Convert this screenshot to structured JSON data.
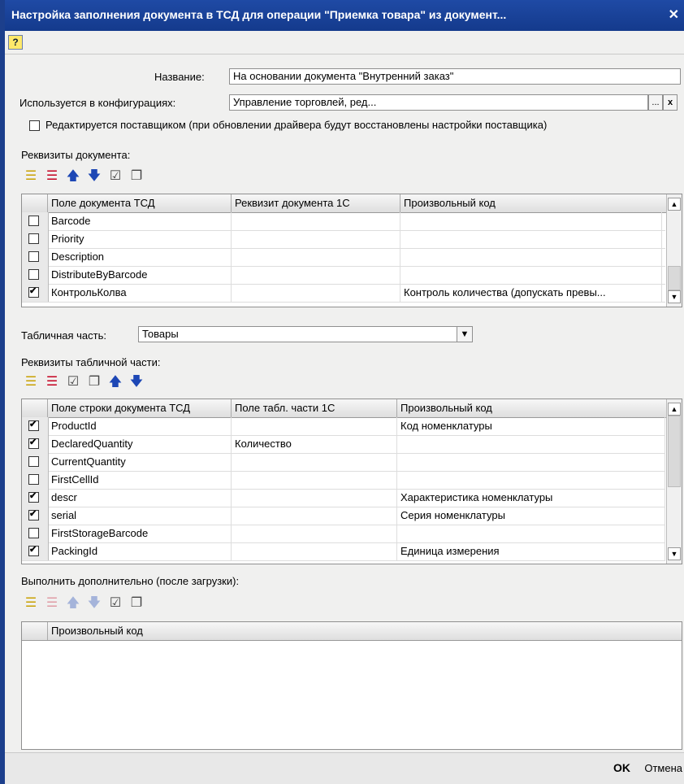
{
  "window": {
    "title": "Настройка заполнения документа в ТСД для операции \"Приемка товара\" из документ...",
    "close_symbol": "✕"
  },
  "help_label": "?",
  "name_label": "Название:",
  "name_value": "На основании документа \"Внутренний заказ\"",
  "config_label": "Используется в конфигурациях:",
  "config_value": "Управление торговлей, ред...",
  "config_select_btn": "...",
  "config_clear_btn": "x",
  "supplier_checkbox_label": "Редактируется поставщиком (при обновлении драйвера будут восстановлены настройки поставщика)",
  "doc_attrs": {
    "label": "Реквизиты документа:",
    "columns": [
      "Поле документа ТСД",
      "Реквизит документа 1С",
      "Произвольный код"
    ],
    "rows": [
      {
        "checked": false,
        "field": "Barcode",
        "attr": "",
        "code": ""
      },
      {
        "checked": false,
        "field": "Priority",
        "attr": "",
        "code": ""
      },
      {
        "checked": false,
        "field": "Description",
        "attr": "",
        "code": ""
      },
      {
        "checked": false,
        "field": "DistributeByBarcode",
        "attr": "",
        "code": ""
      },
      {
        "checked": true,
        "field": "КонтрольКолва",
        "attr": "",
        "code": "Контроль количества (допускать превы..."
      }
    ]
  },
  "table_part": {
    "label": "Табличная часть:",
    "value": "Товары"
  },
  "table_attrs": {
    "label": "Реквизиты табличной части:",
    "columns": [
      "Поле строки документа ТСД",
      "Поле табл. части 1С",
      "Произвольный код"
    ],
    "rows": [
      {
        "checked": true,
        "field": "ProductId",
        "attr": "",
        "code": "Код номенклатуры"
      },
      {
        "checked": true,
        "field": "DeclaredQuantity",
        "attr": "Количество",
        "code": ""
      },
      {
        "checked": false,
        "field": "CurrentQuantity",
        "attr": "",
        "code": ""
      },
      {
        "checked": false,
        "field": "FirstCellId",
        "attr": "",
        "code": ""
      },
      {
        "checked": true,
        "field": "descr",
        "attr": "",
        "code": "Характеристика номенклатуры"
      },
      {
        "checked": true,
        "field": "serial",
        "attr": "",
        "code": "Серия номенклатуры"
      },
      {
        "checked": false,
        "field": "FirstStorageBarcode",
        "attr": "",
        "code": ""
      },
      {
        "checked": true,
        "field": "PackingId",
        "attr": "",
        "code": "Единица измерения"
      }
    ]
  },
  "post_exec": {
    "label": "Выполнить дополнительно (после загрузки):",
    "column": "Произвольный код"
  },
  "buttons": {
    "ok": "OK",
    "cancel": "Отмена"
  },
  "icons": {
    "add": "add-row-icon",
    "delete": "delete-row-icon",
    "up": "move-up-icon",
    "down": "move-down-icon",
    "check_all": "check-all-icon",
    "uncheck_all": "uncheck-all-icon"
  },
  "colors": {
    "titlebar": "#1f4aa5",
    "window_bg": "#f0f0ef",
    "accent_blue": "#1d47b5",
    "delete_red": "#c4001f"
  }
}
